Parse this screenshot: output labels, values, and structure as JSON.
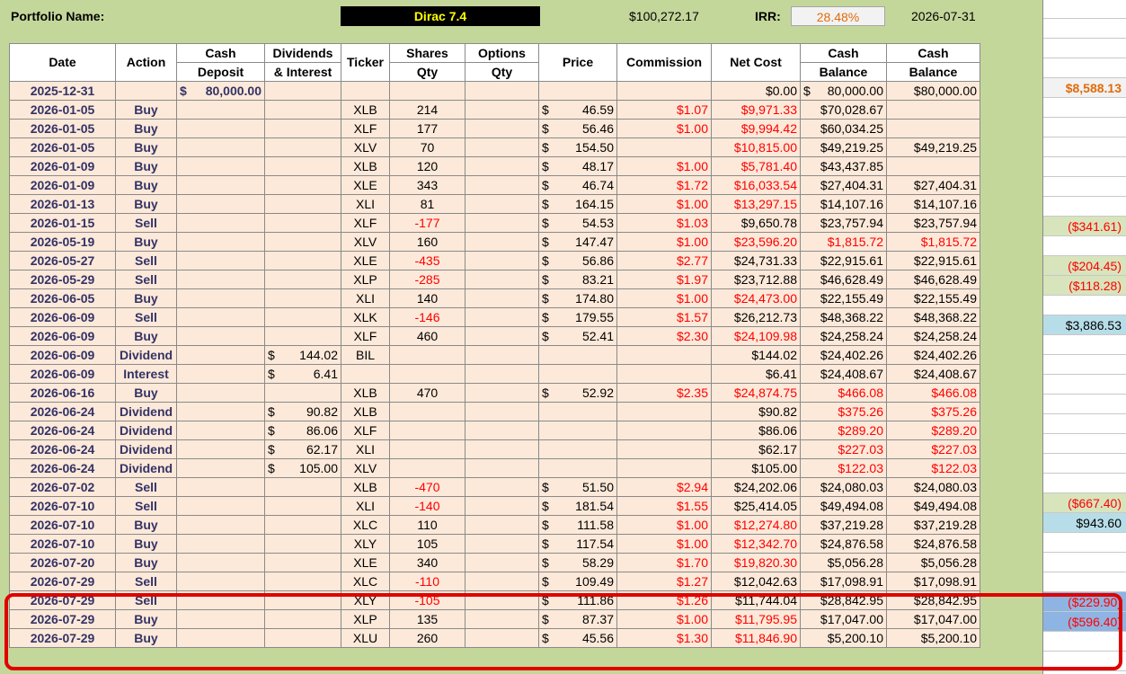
{
  "header": {
    "portfolio_label": "Portfolio Name:",
    "portfolio_name": "Dirac 7.4",
    "portfolio_value": "$100,272.17",
    "irr_label": "IRR:",
    "irr_value": "28.48%",
    "as_of_date": "2026-07-31"
  },
  "columns": {
    "date": "Date",
    "action": "Action",
    "cash_deposit_1": "Cash",
    "cash_deposit_2": "Deposit",
    "dividends_1": "Dividends",
    "dividends_2": "& Interest",
    "ticker": "Ticker",
    "shares_1": "Shares",
    "shares_2": "Qty",
    "options_1": "Options",
    "options_2": "Qty",
    "price": "Price",
    "commission": "Commission",
    "net_cost": "Net Cost",
    "cash_balance_a1": "Cash",
    "cash_balance_a2": "Balance",
    "cash_balance_b1": "Cash",
    "cash_balance_b2": "Balance"
  },
  "rows": [
    {
      "date": "2025-12-31",
      "action": "",
      "deposit": "80,000.00",
      "div": "",
      "ticker": "",
      "qty": "",
      "price": "",
      "commission": "",
      "net_cost": "$0.00",
      "bal_dollar": "$",
      "bal_a": "80,000.00",
      "bal_b": "$80,000.00",
      "side": "$8,588.13",
      "side_style": "orange"
    },
    {
      "date": "2026-01-05",
      "action": "Buy",
      "deposit": "",
      "div": "",
      "ticker": "XLB",
      "qty": "214",
      "price": "46.59",
      "commission": "$1.07",
      "net_cost": "$9,971.33",
      "bal_a": "$70,028.67",
      "bal_b": "",
      "side": ""
    },
    {
      "date": "2026-01-05",
      "action": "Buy",
      "deposit": "",
      "div": "",
      "ticker": "XLF",
      "qty": "177",
      "price": "56.46",
      "commission": "$1.00",
      "net_cost": "$9,994.42",
      "bal_a": "$60,034.25",
      "bal_b": "",
      "side": ""
    },
    {
      "date": "2026-01-05",
      "action": "Buy",
      "deposit": "",
      "div": "",
      "ticker": "XLV",
      "qty": "70",
      "price": "154.50",
      "commission": "",
      "net_cost": "$10,815.00",
      "bal_a": "$49,219.25",
      "bal_b": "$49,219.25",
      "side": ""
    },
    {
      "date": "2026-01-09",
      "action": "Buy",
      "deposit": "",
      "div": "",
      "ticker": "XLB",
      "qty": "120",
      "price": "48.17",
      "commission": "$1.00",
      "net_cost": "$5,781.40",
      "bal_a": "$43,437.85",
      "bal_b": "",
      "side": ""
    },
    {
      "date": "2026-01-09",
      "action": "Buy",
      "deposit": "",
      "div": "",
      "ticker": "XLE",
      "qty": "343",
      "price": "46.74",
      "commission": "$1.72",
      "net_cost": "$16,033.54",
      "bal_a": "$27,404.31",
      "bal_b": "$27,404.31",
      "side": ""
    },
    {
      "date": "2026-01-13",
      "action": "Buy",
      "deposit": "",
      "div": "",
      "ticker": "XLI",
      "qty": "81",
      "price": "164.15",
      "commission": "$1.00",
      "net_cost": "$13,297.15",
      "bal_a": "$14,107.16",
      "bal_b": "$14,107.16",
      "side": ""
    },
    {
      "date": "2026-01-15",
      "action": "Sell",
      "deposit": "",
      "div": "",
      "ticker": "XLF",
      "qty": "-177",
      "price": "54.53",
      "commission": "$1.03",
      "net_cost": "$9,650.78",
      "bal_a": "$23,757.94",
      "bal_b": "$23,757.94",
      "side": "($341.61)",
      "side_style": "neg"
    },
    {
      "date": "2026-05-19",
      "action": "Buy",
      "deposit": "",
      "div": "",
      "ticker": "XLV",
      "ticker_hl": "blue",
      "qty": "160",
      "price": "147.47",
      "commission": "$1.00",
      "net_cost": "$23,596.20",
      "bal_a": "$1,815.72",
      "bal_b": "$1,815.72",
      "bal_red": true,
      "side": ""
    },
    {
      "date": "2026-05-27",
      "action": "Sell",
      "deposit": "",
      "div": "",
      "ticker": "XLE",
      "qty": "-435",
      "price": "56.86",
      "commission": "$2.77",
      "net_cost": "$24,731.33",
      "bal_a": "$22,915.61",
      "bal_b": "$22,915.61",
      "side": "($204.45)",
      "side_style": "neg"
    },
    {
      "date": "2026-05-29",
      "action": "Sell",
      "deposit": "",
      "div": "",
      "ticker": "XLP",
      "qty": "-285",
      "price": "83.21",
      "commission": "$1.97",
      "net_cost": "$23,712.88",
      "bal_a": "$46,628.49",
      "bal_b": "$46,628.49",
      "side": "($118.28)",
      "side_style": "neg"
    },
    {
      "date": "2026-06-05",
      "action": "Buy",
      "deposit": "",
      "div": "",
      "ticker": "XLI",
      "qty": "140",
      "price": "174.80",
      "commission": "$1.00",
      "net_cost": "$24,473.00",
      "bal_a": "$22,155.49",
      "bal_b": "$22,155.49",
      "side": ""
    },
    {
      "date": "2026-06-09",
      "action": "Sell",
      "deposit": "",
      "div": "",
      "ticker": "XLK",
      "qty": "-146",
      "price": "179.55",
      "commission": "$1.57",
      "net_cost": "$26,212.73",
      "bal_a": "$48,368.22",
      "bal_b": "$48,368.22",
      "side": "$3,886.53",
      "side_style": "pos"
    },
    {
      "date": "2026-06-09",
      "action": "Buy",
      "deposit": "",
      "div": "",
      "ticker": "XLF",
      "ticker_hl": "blue",
      "qty": "460",
      "price": "52.41",
      "commission": "$2.30",
      "net_cost": "$24,109.98",
      "bal_a": "$24,258.24",
      "bal_b": "$24,258.24",
      "side": ""
    },
    {
      "date": "2026-06-09",
      "action": "Dividend",
      "deposit": "",
      "div": "144.02",
      "ticker": "BIL",
      "qty": "",
      "price": "",
      "commission": "",
      "net_cost": "$144.02",
      "bal_a": "$24,402.26",
      "bal_b": "$24,402.26",
      "side": ""
    },
    {
      "date": "2026-06-09",
      "action": "Interest",
      "deposit": "",
      "div": "6.41",
      "ticker": "",
      "qty": "",
      "price": "",
      "commission": "",
      "net_cost": "$6.41",
      "bal_a": "$24,408.67",
      "bal_b": "$24,408.67",
      "side": ""
    },
    {
      "date": "2026-06-16",
      "action": "Buy",
      "deposit": "",
      "div": "",
      "ticker": "XLB",
      "qty": "470",
      "price": "52.92",
      "commission": "$2.35",
      "net_cost": "$24,874.75",
      "bal_a": "$466.08",
      "bal_b": "$466.08",
      "bal_red": true,
      "side": ""
    },
    {
      "date": "2026-06-24",
      "action": "Dividend",
      "deposit": "",
      "div": "90.82",
      "ticker": "XLB",
      "qty": "",
      "price": "",
      "commission": "",
      "net_cost": "$90.82",
      "bal_a": "$375.26",
      "bal_b": "$375.26",
      "bal_red": true,
      "side": ""
    },
    {
      "date": "2026-06-24",
      "action": "Dividend",
      "deposit": "",
      "div": "86.06",
      "ticker": "XLF",
      "qty": "",
      "price": "",
      "commission": "",
      "net_cost": "$86.06",
      "bal_a": "$289.20",
      "bal_b": "$289.20",
      "bal_red": true,
      "side": ""
    },
    {
      "date": "2026-06-24",
      "action": "Dividend",
      "deposit": "",
      "div": "62.17",
      "ticker": "XLI",
      "qty": "",
      "price": "",
      "commission": "",
      "net_cost": "$62.17",
      "bal_a": "$227.03",
      "bal_b": "$227.03",
      "bal_red": true,
      "side": ""
    },
    {
      "date": "2026-06-24",
      "action": "Dividend",
      "deposit": "",
      "div": "105.00",
      "ticker": "XLV",
      "qty": "",
      "price": "",
      "commission": "",
      "net_cost": "$105.00",
      "bal_a": "$122.03",
      "bal_b": "$122.03",
      "bal_red": true,
      "side": ""
    },
    {
      "date": "2026-07-02",
      "action": "Sell",
      "deposit": "",
      "div": "",
      "ticker": "XLB",
      "qty": "-470",
      "price": "51.50",
      "commission": "$2.94",
      "net_cost": "$24,202.06",
      "bal_a": "$24,080.03",
      "bal_b": "$24,080.03",
      "side": "($667.40)",
      "side_style": "neg"
    },
    {
      "date": "2026-07-10",
      "action": "Sell",
      "deposit": "",
      "div": "",
      "ticker": "XLI",
      "qty": "-140",
      "price": "181.54",
      "commission": "$1.55",
      "net_cost": "$25,414.05",
      "bal_a": "$49,494.08",
      "bal_b": "$49,494.08",
      "side": "$943.60",
      "side_style": "pos"
    },
    {
      "date": "2026-07-10",
      "action": "Buy",
      "deposit": "",
      "div": "",
      "ticker": "XLC",
      "qty": "110",
      "price": "111.58",
      "commission": "$1.00",
      "net_cost": "$12,274.80",
      "bal_a": "$37,219.28",
      "bal_b": "$37,219.28",
      "side": ""
    },
    {
      "date": "2026-07-10",
      "action": "Buy",
      "deposit": "",
      "div": "",
      "ticker": "XLY",
      "qty": "105",
      "price": "117.54",
      "commission": "$1.00",
      "net_cost": "$12,342.70",
      "bal_a": "$24,876.58",
      "bal_b": "$24,876.58",
      "side": ""
    },
    {
      "date": "2026-07-20",
      "action": "Buy",
      "deposit": "",
      "div": "",
      "ticker": "XLE",
      "ticker_hl": "green",
      "qty": "340",
      "price": "58.29",
      "commission": "$1.70",
      "net_cost": "$19,820.30",
      "bal_a": "$5,056.28",
      "bal_b": "$5,056.28",
      "side": ""
    },
    {
      "date": "2026-07-29",
      "action": "Sell",
      "deposit": "",
      "div": "",
      "ticker": "XLC",
      "qty": "-110",
      "price": "109.49",
      "commission": "$1.27",
      "net_cost": "$12,042.63",
      "bal_a": "$17,098.91",
      "bal_b": "$17,098.91",
      "side": "($229.90)",
      "side_style": "neg-blue"
    },
    {
      "date": "2026-07-29",
      "action": "Sell",
      "deposit": "",
      "div": "",
      "ticker": "XLY",
      "qty": "-105",
      "price": "111.86",
      "commission": "$1.26",
      "net_cost": "$11,744.04",
      "bal_a": "$28,842.95",
      "bal_b": "$28,842.95",
      "side": "($596.40)",
      "side_style": "neg-blue"
    },
    {
      "date": "2026-07-29",
      "action": "Buy",
      "deposit": "",
      "div": "",
      "ticker": "XLP",
      "ticker_hl": "green",
      "qty": "135",
      "price": "87.37",
      "commission": "$1.00",
      "net_cost": "$11,795.95",
      "bal_a": "$17,047.00",
      "bal_b": "$17,047.00",
      "side": ""
    },
    {
      "date": "2026-07-29",
      "action": "Buy",
      "deposit": "",
      "div": "",
      "ticker": "XLU",
      "ticker_hl": "lightgreen",
      "qty": "260",
      "price": "45.56",
      "commission": "$1.30",
      "net_cost": "$11,846.90",
      "bal_a": "$5,200.10",
      "bal_b": "$5,200.10",
      "side": ""
    }
  ],
  "currency_symbol": "$"
}
